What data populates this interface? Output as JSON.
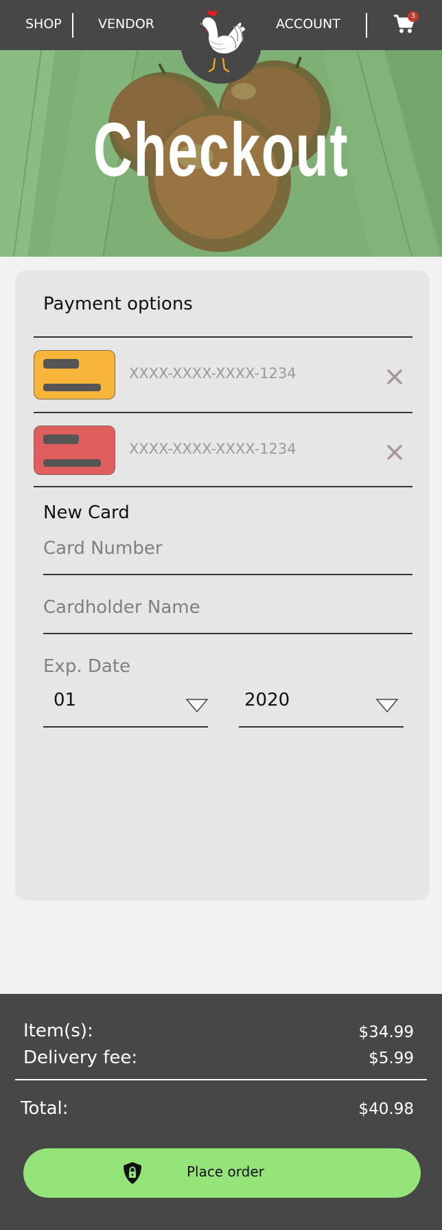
{
  "nav": {
    "shop": "SHOP",
    "vendor": "VENDOR",
    "account": "ACCOUNT",
    "cart_count": "3",
    "logo_icon": "rooster-logo",
    "cart_icon": "shopping-cart-icon"
  },
  "hero": {
    "title": "Checkout"
  },
  "payment": {
    "title": "Payment options",
    "saved_cards": [
      {
        "number": "XXXX-XXXX-XXXX-1234",
        "color": "#f7b53a"
      },
      {
        "number": "XXXX-XXXX-XXXX-1234",
        "color": "#e05e5e"
      }
    ],
    "new_card": {
      "title": "New Card",
      "card_number_placeholder": "Card Number",
      "cardholder_placeholder": "Cardholder Name",
      "exp_label": "Exp. Date",
      "month": "01",
      "year": "2020"
    }
  },
  "summary": {
    "items_label": "Item(s):",
    "items_value": "$34.99",
    "delivery_label": "Delivery fee:",
    "delivery_value": "$5.99",
    "total_label": "Total:",
    "total_value": "$40.98",
    "button_label": "Place order",
    "button_color": "#94e47a"
  },
  "colors": {
    "nav_bg": "#474747",
    "panel_bg": "#e6e6e6",
    "page_bg": "#f2f2f2"
  }
}
